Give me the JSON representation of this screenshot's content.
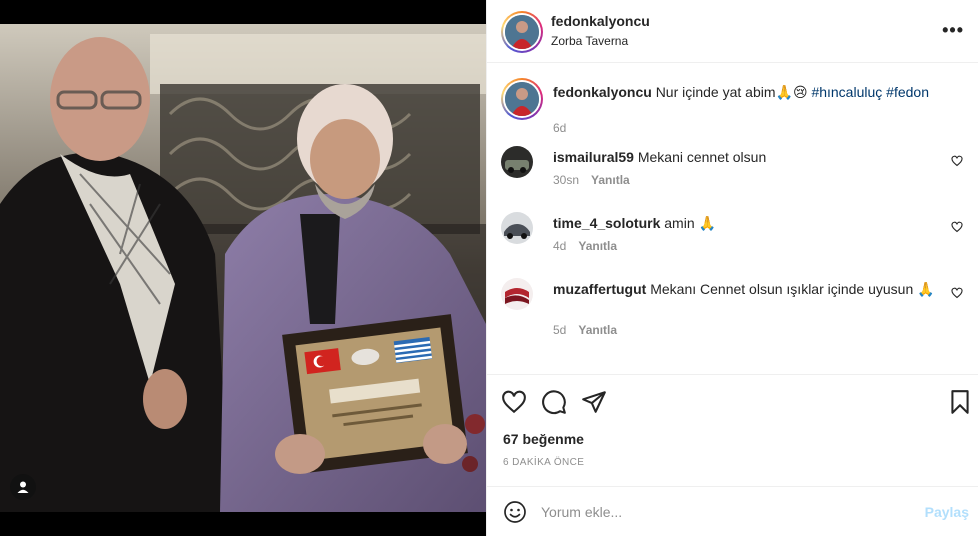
{
  "post": {
    "author": "fedonkalyoncu",
    "location": "Zorba Taverna"
  },
  "caption": {
    "username": "fedonkalyoncu",
    "text": "Nur içinde yat abim🙏😢",
    "hashtags": "#hıncaluluç #fedon",
    "age": "6d"
  },
  "comments": [
    {
      "username": "ismailural59",
      "text": "Mekani cennet olsun",
      "age": "30sn",
      "reply": "Yanıtla"
    },
    {
      "username": "time_4_soloturk",
      "text": "amin 🙏",
      "age": "4d",
      "reply": "Yanıtla"
    },
    {
      "username": "muzaffertugut",
      "text": "Mekanı Cennet olsun ışıklar içinde uyusun 🙏",
      "age": "5d",
      "reply": "Yanıtla"
    }
  ],
  "engagement": {
    "likes": "67 beğenme",
    "posted": "6 DAKİKA ÖNCE"
  },
  "comment_box": {
    "placeholder": "Yorum ekle...",
    "submit": "Paylaş"
  },
  "icons": {
    "more": "more-options-icon",
    "like": "heart-icon",
    "comment": "comment-icon",
    "share": "share-icon",
    "save": "bookmark-icon",
    "emoji": "emoji-icon",
    "tag": "user-tag-icon"
  },
  "colors": {
    "link": "#00376b",
    "share_disabled": "#b2dffc",
    "meta": "#8e8e8e"
  }
}
